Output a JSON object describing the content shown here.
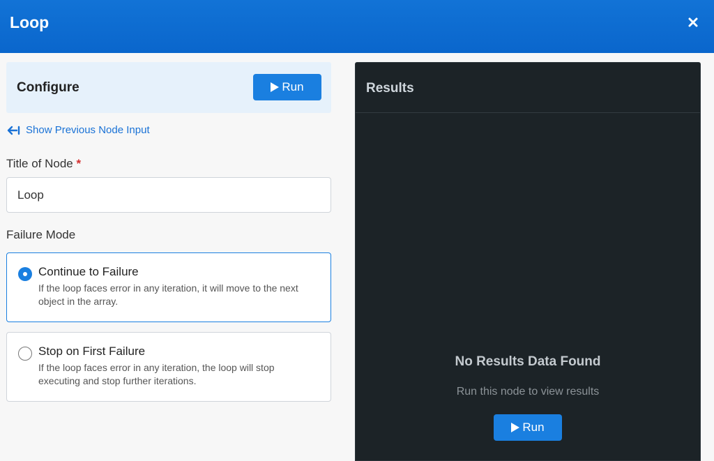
{
  "header": {
    "title": "Loop"
  },
  "configure": {
    "title": "Configure",
    "run_label": "Run"
  },
  "prev_input": {
    "label": "Show Previous Node Input"
  },
  "title_field": {
    "label": "Title of Node",
    "required_mark": "*",
    "value": "Loop"
  },
  "failure_mode": {
    "label": "Failure Mode",
    "options": [
      {
        "title": "Continue to Failure",
        "description": "If the loop faces error in any iteration, it will move to the next object in the array.",
        "selected": true
      },
      {
        "title": "Stop on First Failure",
        "description": "If the loop faces error in any iteration, the loop will stop executing and stop further iterations.",
        "selected": false
      }
    ]
  },
  "results": {
    "title": "Results",
    "empty_title": "No Results Data Found",
    "empty_subtitle": "Run this node to view results",
    "run_label": "Run"
  },
  "colors": {
    "header": "#0a66cc",
    "accent": "#1a7fe0",
    "results_bg": "#1c2327"
  }
}
